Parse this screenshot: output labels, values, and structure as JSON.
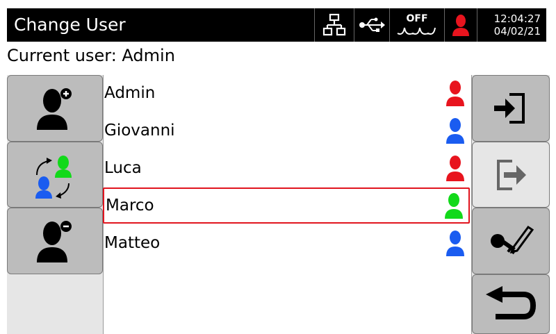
{
  "header": {
    "title": "Change User",
    "status": {
      "wave_label": "OFF",
      "time": "12:04:27",
      "date": "04/02/21"
    }
  },
  "current_user_text": "Current user: Admin",
  "users": [
    {
      "name": "Admin",
      "color": "#e8141e"
    },
    {
      "name": "Giovanni",
      "color": "#1a5cf0"
    },
    {
      "name": "Luca",
      "color": "#e8141e"
    },
    {
      "name": "Marco",
      "color": "#12d91a",
      "selected": true
    },
    {
      "name": "Matteo",
      "color": "#1a5cf0"
    }
  ],
  "colors": {
    "admin": "#e8141e",
    "user": "#1a5cf0",
    "active": "#12d91a",
    "selection": "#e1141e"
  },
  "left_buttons": [
    {
      "name": "add-user-button",
      "icon": "user-plus-icon"
    },
    {
      "name": "switch-user-button",
      "icon": "user-switch-icon"
    },
    {
      "name": "remove-user-button",
      "icon": "user-minus-icon"
    }
  ],
  "right_buttons": [
    {
      "name": "login-button",
      "icon": "login-icon"
    },
    {
      "name": "logout-button",
      "icon": "logout-icon",
      "disabled": true
    },
    {
      "name": "change-password-button",
      "icon": "key-pencil-icon"
    },
    {
      "name": "back-button",
      "icon": "return-arrow-icon"
    }
  ]
}
